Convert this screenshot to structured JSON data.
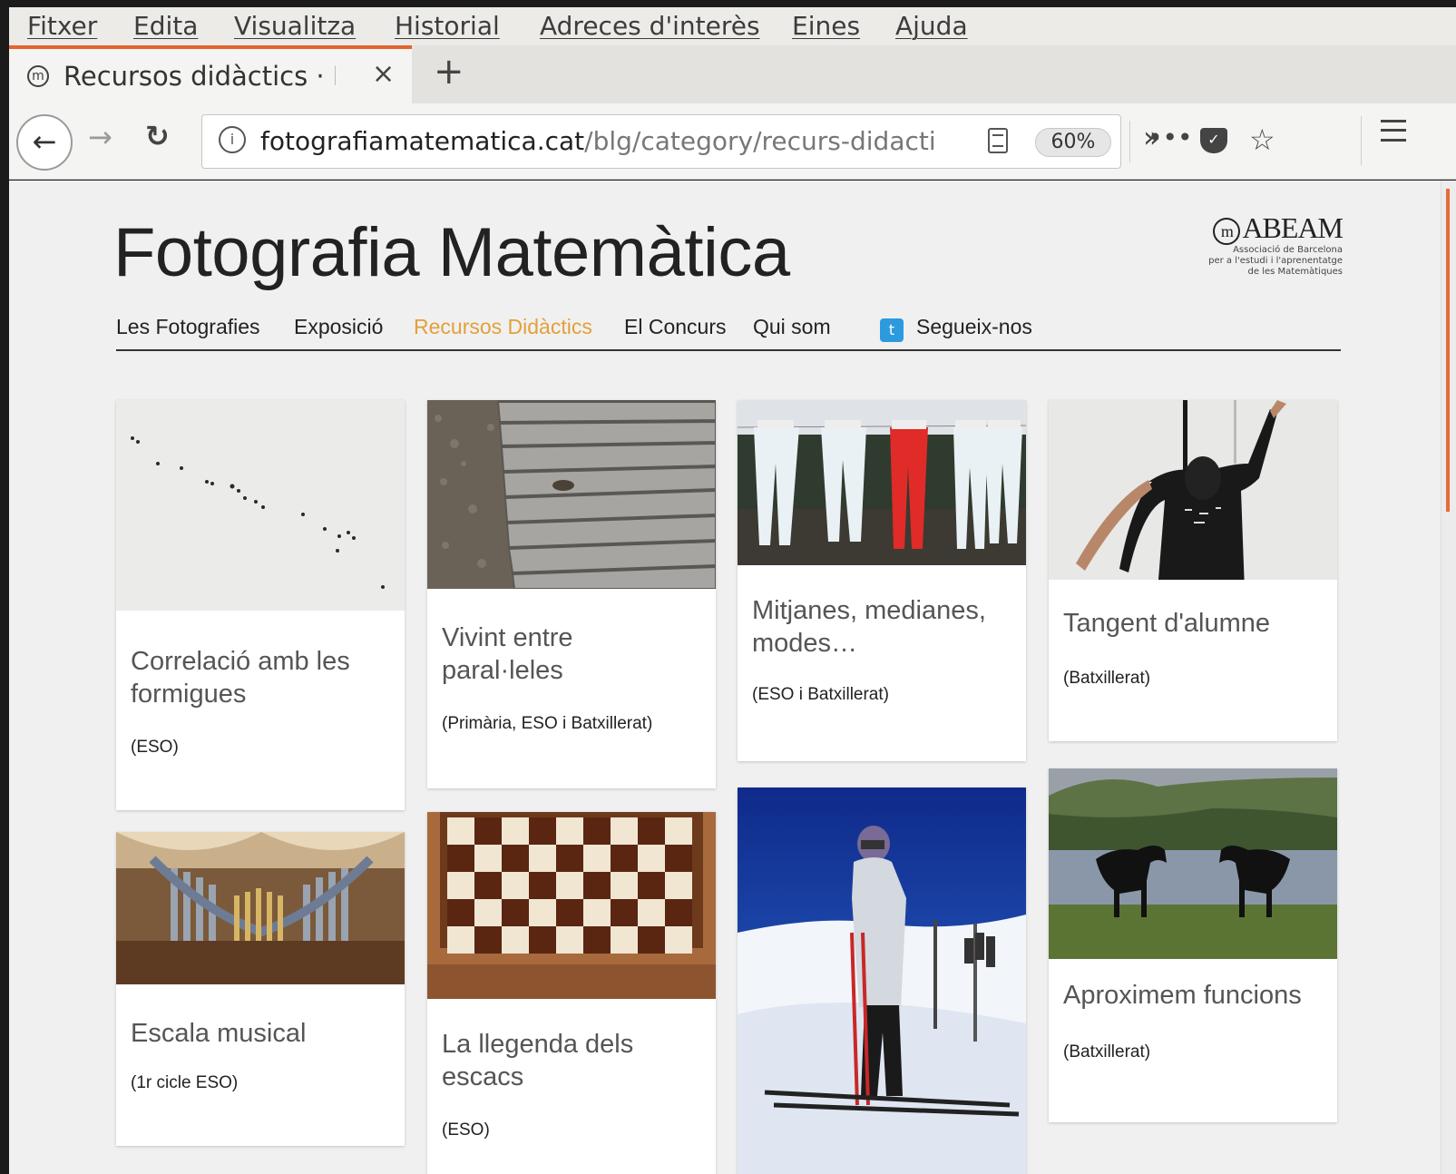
{
  "menubar": {
    "items": [
      "Fitxer",
      "Edita",
      "Visualitza",
      "Historial",
      "Adreces d'interès",
      "Eines",
      "Ajuda"
    ]
  },
  "tab": {
    "title": "Recursos didàctics · Foto",
    "close_label": "×",
    "new_tab_label": "+"
  },
  "navbar": {
    "url_host": "fotografiamatematica.cat",
    "url_path": "/blg/category/recurs-didacti",
    "zoom": "60%"
  },
  "site": {
    "title": "Fotografia Matemàtica",
    "logo_name": "ABEAM",
    "logo_lines": [
      "Associació de Barcelona",
      "per a l'estudi i l'aprenentatge",
      "de les Matemàtiques"
    ],
    "nav": [
      "Les Fotografies",
      "Exposició",
      "Recursos Didàctics",
      "El Concurs",
      "Qui som",
      "Segueix-nos"
    ],
    "active_nav": "Recursos Didàctics"
  },
  "cards": [
    {
      "title": "Correlació amb les formigues",
      "level": "(ESO)",
      "image": "ants-on-snow"
    },
    {
      "title": "Vivint entre paral·leles",
      "level": "(Primària, ESO i Batxillerat)",
      "image": "wooden-planks"
    },
    {
      "title": "Mitjanes, medianes, modes…",
      "level": "(ESO i Batxillerat)",
      "image": "tights-on-clothesline"
    },
    {
      "title": "Tangent d'alumne",
      "level": "(Batxillerat)",
      "image": "student-against-wall"
    },
    {
      "title": "Escala musical",
      "level": "(1r cicle ESO)",
      "image": "organ-pipes"
    },
    {
      "title": "La llegenda dels escacs",
      "level": "(ESO)",
      "image": "chessboard-with-grains"
    },
    {
      "title": "",
      "level": "",
      "image": "skier-on-snow"
    },
    {
      "title": "Aproximem funcions",
      "level": "(Batxillerat)",
      "image": "horses-by-lake"
    }
  ],
  "colors": {
    "accent_nav": "#e3a039",
    "tab_accent": "#e2642f",
    "twitter": "#2d9adf"
  }
}
